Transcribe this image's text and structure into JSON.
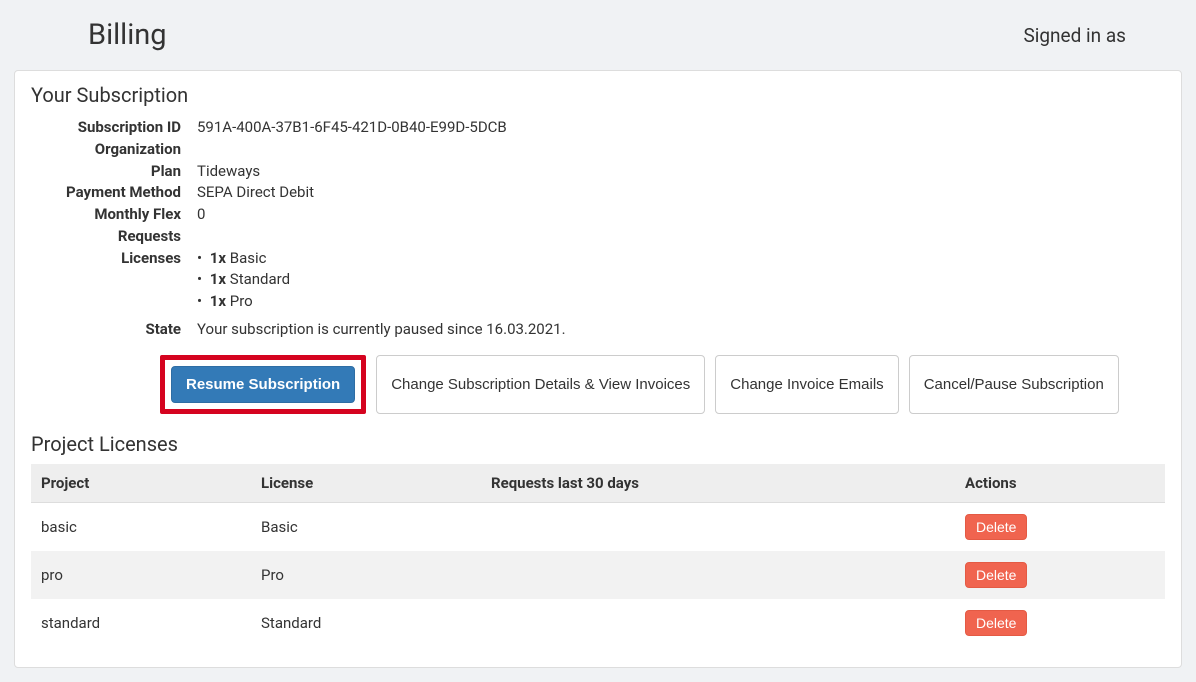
{
  "header": {
    "title": "Billing",
    "signed_in": "Signed in as"
  },
  "subscription": {
    "title": "Your Subscription",
    "labels": {
      "subscription_id": "Subscription ID",
      "organization": "Organization",
      "plan": "Plan",
      "payment_method": "Payment Method",
      "monthly_flex": "Monthly Flex Requests",
      "licenses": "Licenses",
      "state": "State"
    },
    "values": {
      "subscription_id": "591A-400A-37B1-6F45-421D-0B40-E99D-5DCB",
      "organization": "",
      "plan": "Tideways",
      "payment_method": "SEPA Direct Debit",
      "monthly_flex": "0",
      "state": "Your subscription is currently paused since 16.03.2021."
    },
    "licenses": [
      {
        "qty": "1x",
        "name": "Basic"
      },
      {
        "qty": "1x",
        "name": "Standard"
      },
      {
        "qty": "1x",
        "name": "Pro"
      }
    ]
  },
  "buttons": {
    "resume": "Resume Subscription",
    "change_details": "Change Subscription Details & View Invoices",
    "change_emails": "Change Invoice Emails",
    "cancel_pause": "Cancel/Pause Subscription"
  },
  "projects": {
    "title": "Project Licenses",
    "columns": {
      "project": "Project",
      "license": "License",
      "requests": "Requests last 30 days",
      "actions": "Actions"
    },
    "delete_label": "Delete",
    "rows": [
      {
        "project": "basic",
        "license": "Basic",
        "requests": ""
      },
      {
        "project": "pro",
        "license": "Pro",
        "requests": ""
      },
      {
        "project": "standard",
        "license": "Standard",
        "requests": ""
      }
    ]
  }
}
